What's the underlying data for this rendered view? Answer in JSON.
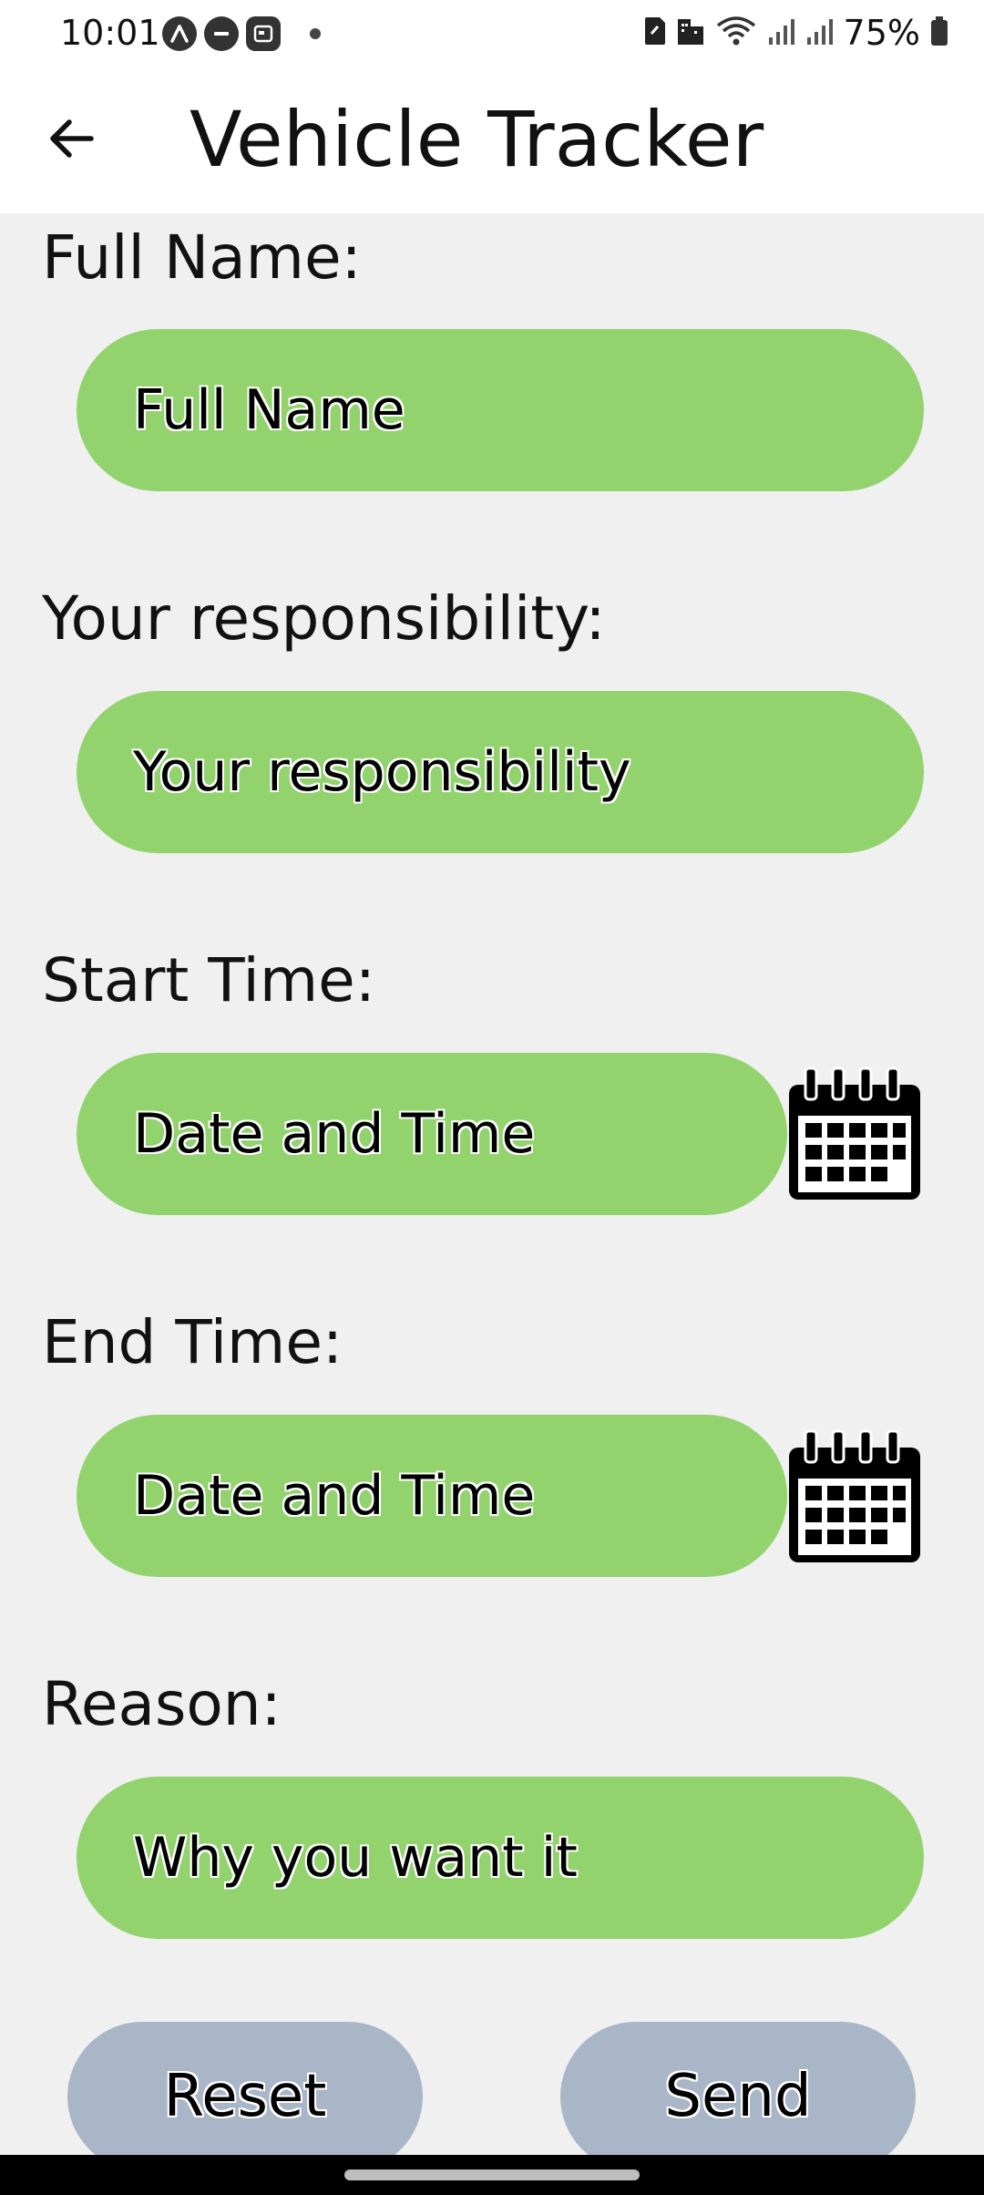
{
  "status_bar": {
    "time": "10:01",
    "battery_text": "75%",
    "icons_left": [
      "app-a-icon",
      "minus-circle-icon",
      "card-icon",
      "dot-icon"
    ],
    "icons_right": [
      "sim-icon",
      "building-icon",
      "wifi-icon",
      "signal-icon",
      "signal-icon",
      "battery-icon"
    ]
  },
  "app_bar": {
    "title": "Vehicle Tracker",
    "back_icon": "arrow-left-icon"
  },
  "form": {
    "full_name": {
      "label": "Full Name:",
      "placeholder": "Full Name"
    },
    "responsibility": {
      "label": "Your responsibility:",
      "placeholder": "Your responsibility"
    },
    "start_time": {
      "label": "Start Time:",
      "placeholder": "Date and Time",
      "icon": "calendar-icon"
    },
    "end_time": {
      "label": "End Time:",
      "placeholder": "Date and Time",
      "icon": "calendar-icon"
    },
    "reason": {
      "label": "Reason:",
      "placeholder": "Why you want it"
    }
  },
  "actions": {
    "reset_label": "Reset",
    "send_label": "Send"
  },
  "colors": {
    "input_fill": "#92d36e",
    "button_fill": "#a9b6c7",
    "background": "#f0f0f0"
  }
}
